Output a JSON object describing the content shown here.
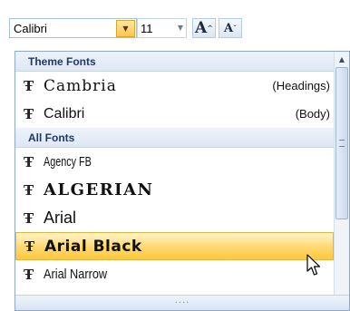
{
  "toolbar": {
    "font_value": "Calibri",
    "size_value": "11",
    "grow_label": "A",
    "shrink_label": "A"
  },
  "theme_section": {
    "label": "Theme Fonts",
    "items": [
      {
        "name": "Cambria",
        "hint": "(Headings)"
      },
      {
        "name": "Calibri",
        "hint": "(Body)"
      }
    ]
  },
  "all_section": {
    "label": "All Fonts",
    "items": [
      {
        "name": "Agency FB"
      },
      {
        "name": "ALGERIAN"
      },
      {
        "name": "Arial"
      },
      {
        "name": "Arial Black"
      },
      {
        "name": "Arial Narrow"
      }
    ]
  },
  "icons": {
    "font_type_glyph": "Ŧ",
    "dropdown": "chevron-down-icon",
    "scroll_up": "chevron-up-icon"
  },
  "colors": {
    "highlight": "#ffd86e",
    "section_text": "#1f3a66"
  }
}
